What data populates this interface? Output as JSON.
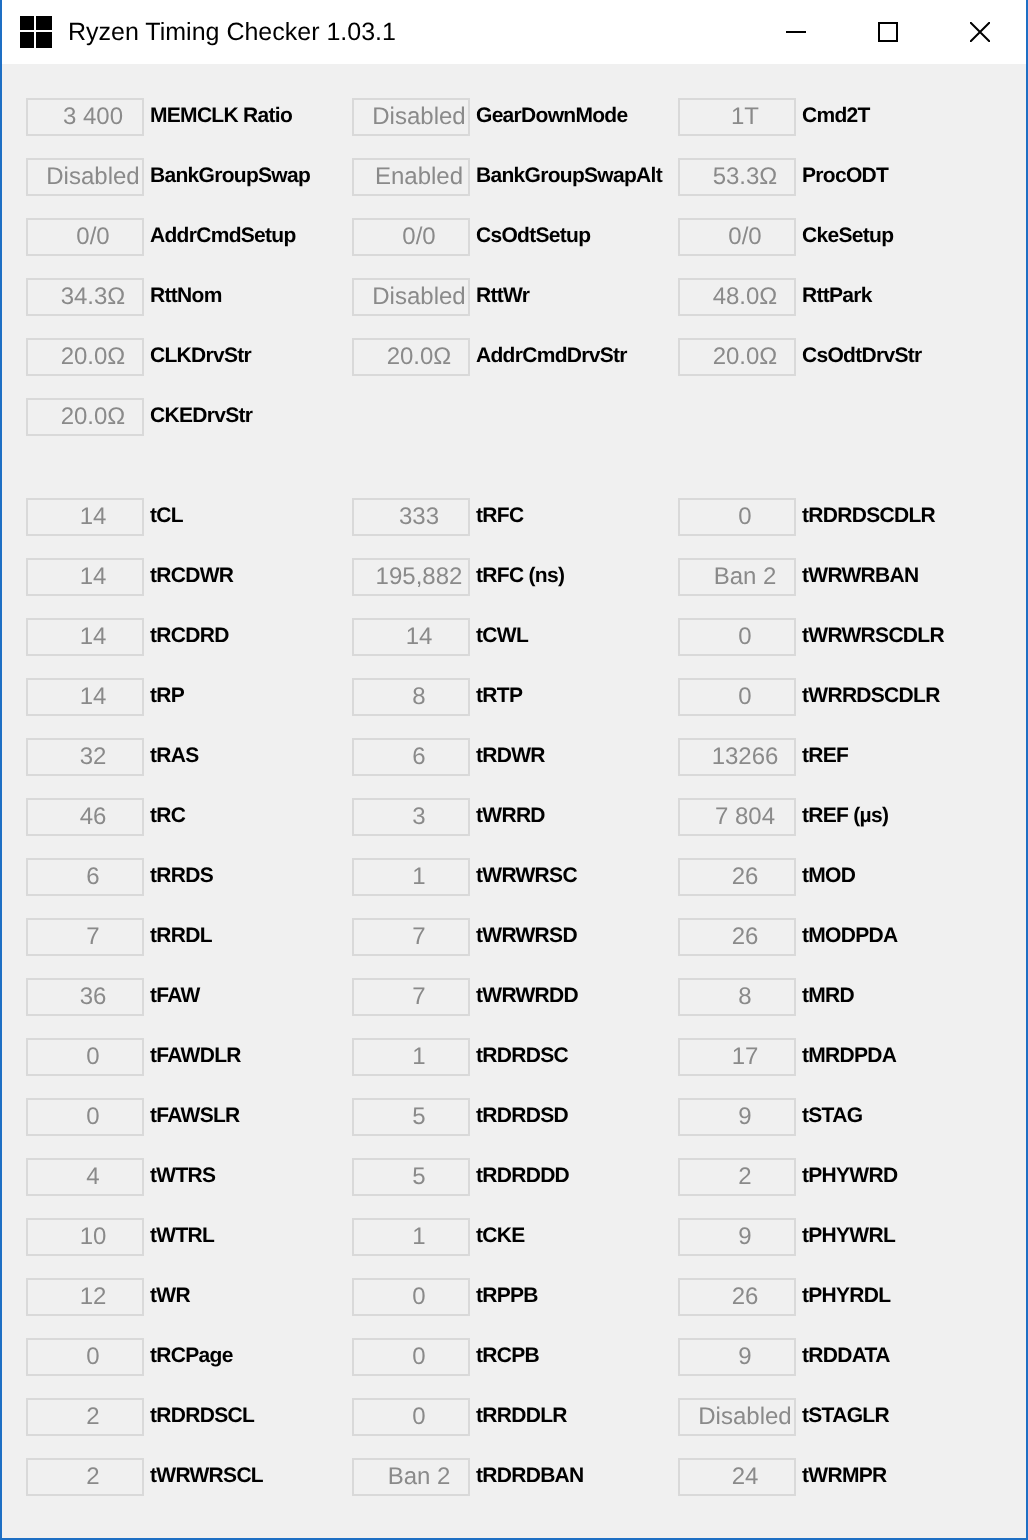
{
  "window": {
    "title": "Ryzen Timing Checker 1.03.1"
  },
  "sections": [
    {
      "rows": [
        {
          "value": "3 400",
          "label": "MEMCLK Ratio"
        },
        {
          "value": "Disabled",
          "label": "GearDownMode"
        },
        {
          "value": "1T",
          "label": "Cmd2T"
        },
        {
          "value": "Disabled",
          "label": "BankGroupSwap"
        },
        {
          "value": "Enabled",
          "label": "BankGroupSwapAlt"
        },
        {
          "value": "53.3Ω",
          "label": "ProcODT"
        },
        {
          "value": "0/0",
          "label": "AddrCmdSetup"
        },
        {
          "value": "0/0",
          "label": "CsOdtSetup"
        },
        {
          "value": "0/0",
          "label": "CkeSetup"
        },
        {
          "value": "34.3Ω",
          "label": "RttNom"
        },
        {
          "value": "Disabled",
          "label": "RttWr"
        },
        {
          "value": "48.0Ω",
          "label": "RttPark"
        },
        {
          "value": "20.0Ω",
          "label": "CLKDrvStr"
        },
        {
          "value": "20.0Ω",
          "label": "AddrCmdDrvStr"
        },
        {
          "value": "20.0Ω",
          "label": "CsOdtDrvStr"
        },
        {
          "value": "20.0Ω",
          "label": "CKEDrvStr"
        }
      ]
    },
    {
      "rows": [
        {
          "value": "14",
          "label": "tCL"
        },
        {
          "value": "333",
          "label": "tRFC"
        },
        {
          "value": "0",
          "label": "tRDRDSCDLR"
        },
        {
          "value": "14",
          "label": "tRCDWR"
        },
        {
          "value": "195,882",
          "label": "tRFC (ns)"
        },
        {
          "value": "Ban 2",
          "label": "tWRWRBAN"
        },
        {
          "value": "14",
          "label": "tRCDRD"
        },
        {
          "value": "14",
          "label": "tCWL"
        },
        {
          "value": "0",
          "label": "tWRWRSCDLR"
        },
        {
          "value": "14",
          "label": "tRP"
        },
        {
          "value": "8",
          "label": "tRTP"
        },
        {
          "value": "0",
          "label": "tWRRDSCDLR"
        },
        {
          "value": "32",
          "label": "tRAS"
        },
        {
          "value": "6",
          "label": "tRDWR"
        },
        {
          "value": "13266",
          "label": "tREF"
        },
        {
          "value": "46",
          "label": "tRC"
        },
        {
          "value": "3",
          "label": "tWRRD"
        },
        {
          "value": "7 804",
          "label": "tREF (µs)"
        },
        {
          "value": "6",
          "label": "tRRDS"
        },
        {
          "value": "1",
          "label": "tWRWRSC"
        },
        {
          "value": "26",
          "label": "tMOD"
        },
        {
          "value": "7",
          "label": "tRRDL"
        },
        {
          "value": "7",
          "label": "tWRWRSD"
        },
        {
          "value": "26",
          "label": "tMODPDA"
        },
        {
          "value": "36",
          "label": "tFAW"
        },
        {
          "value": "7",
          "label": "tWRWRDD"
        },
        {
          "value": "8",
          "label": "tMRD"
        },
        {
          "value": "0",
          "label": "tFAWDLR"
        },
        {
          "value": "1",
          "label": "tRDRDSC"
        },
        {
          "value": "17",
          "label": "tMRDPDA"
        },
        {
          "value": "0",
          "label": "tFAWSLR"
        },
        {
          "value": "5",
          "label": "tRDRDSD"
        },
        {
          "value": "9",
          "label": "tSTAG"
        },
        {
          "value": "4",
          "label": "tWTRS"
        },
        {
          "value": "5",
          "label": "tRDRDDD"
        },
        {
          "value": "2",
          "label": "tPHYWRD"
        },
        {
          "value": "10",
          "label": "tWTRL"
        },
        {
          "value": "1",
          "label": "tCKE"
        },
        {
          "value": "9",
          "label": "tPHYWRL"
        },
        {
          "value": "12",
          "label": "tWR"
        },
        {
          "value": "0",
          "label": "tRPPB"
        },
        {
          "value": "26",
          "label": "tPHYRDL"
        },
        {
          "value": "0",
          "label": "tRCPage"
        },
        {
          "value": "0",
          "label": "tRCPB"
        },
        {
          "value": "9",
          "label": "tRDDATA"
        },
        {
          "value": "2",
          "label": "tRDRDSCL"
        },
        {
          "value": "0",
          "label": "tRRDDLR"
        },
        {
          "value": "Disabled",
          "label": "tSTAGLR"
        },
        {
          "value": "2",
          "label": "tWRWRSCL"
        },
        {
          "value": "Ban 2",
          "label": "tRDRDBAN"
        },
        {
          "value": "24",
          "label": "tWRMPR"
        }
      ]
    }
  ]
}
